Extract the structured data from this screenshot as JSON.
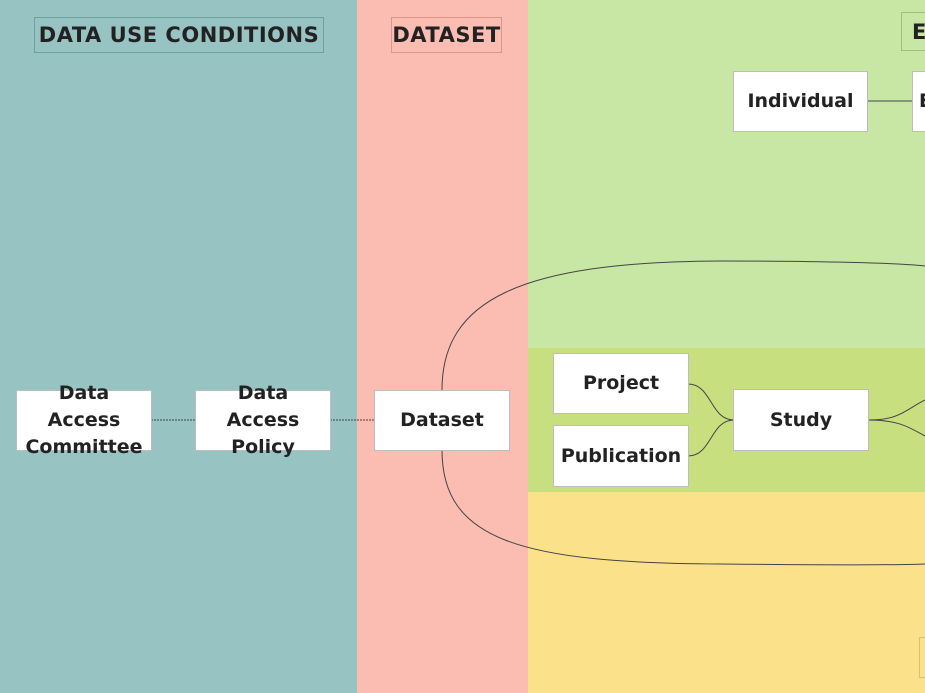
{
  "lanes": {
    "data_use_conditions": {
      "title": "DATA USE CONDITIONS",
      "color": "#97c3c3"
    },
    "dataset": {
      "title": "DATASET",
      "color": "#fbbcb2"
    },
    "experiment": {
      "title": "E",
      "color": "#c8e6a4"
    },
    "study_band": {
      "color": "#c8df80"
    },
    "bottom_band": {
      "color": "#fbe18a"
    }
  },
  "nodes": {
    "dac": "Data Access Committee",
    "dap": "Data Access Policy",
    "dataset": "Dataset",
    "individual": "Individual",
    "individual_right": "E",
    "project": "Project",
    "publication": "Publication",
    "study": "Study"
  }
}
